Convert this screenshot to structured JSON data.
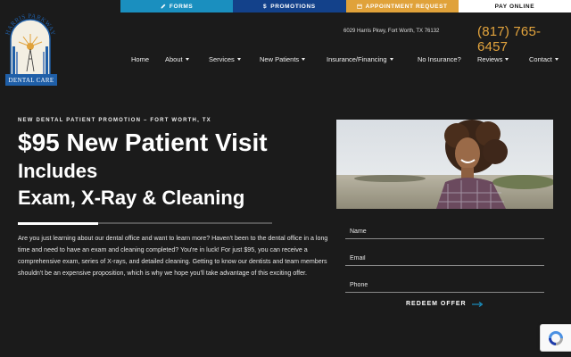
{
  "topbar": {
    "forms": "Forms",
    "promotions": "Promotions",
    "appointment": "Appointment Request",
    "pay": "Pay Online"
  },
  "logo": {
    "arch_text": "HARRIS PARKWAY",
    "band_text": "DENTAL CARE"
  },
  "header": {
    "address": "6029 Harris Pkwy, Fort Worth, TX 76132",
    "phone": "(817) 765-6457"
  },
  "nav": {
    "items": [
      {
        "label": "Home"
      },
      {
        "label": "About"
      },
      {
        "label": "Services"
      },
      {
        "label": "New Patients"
      },
      {
        "label": "Insurance/Financing"
      },
      {
        "label": "No Insurance?"
      },
      {
        "label": "Reviews"
      },
      {
        "label": "Contact"
      }
    ]
  },
  "promo": {
    "kicker": "NEW DENTAL PATIENT PROMOTION – FORT WORTH, TX",
    "headline": "$95 New Patient Visit",
    "subhead_1": "Includes",
    "subhead_2": "Exam, X-Ray & Cleaning",
    "body": "Are you just learning about our dental office and want to learn more? Haven't been to the dental office in a long time and need to have an exam and cleaning completed? You're in luck! For just $95, you can receive a comprehensive exam, series of X-rays, and detailed cleaning. Getting to know our dentists and team members shouldn't be an expensive proposition, which is why we hope you'll take advantage of this exciting offer."
  },
  "form": {
    "name_placeholder": "Name",
    "email_placeholder": "Email",
    "phone_placeholder": "Phone",
    "submit_label": "REDEEM OFFER"
  },
  "colors": {
    "background": "#1b1b1b",
    "forms_bar": "#1a8fbf",
    "promotions_bar": "#13418a",
    "appointment_bar": "#e0a23a",
    "phone_accent": "#e3a43d",
    "redeem_arrow": "#1a8fbf"
  }
}
